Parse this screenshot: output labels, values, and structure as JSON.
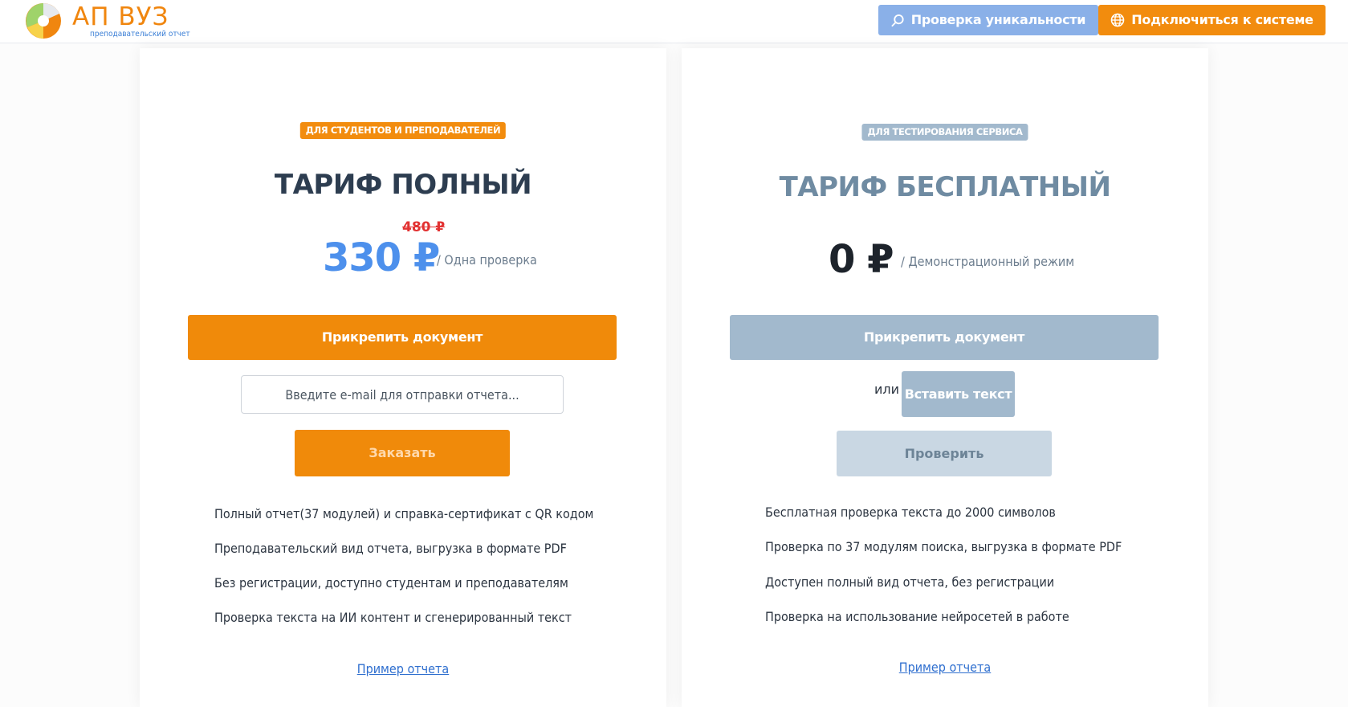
{
  "header": {
    "logo_title": "АП ВУЗ",
    "logo_subtitle": "преподавательский отчет",
    "check_button": "Проверка уникальности",
    "connect_button": "Подключиться к системе",
    "brand_orange": "#f28c0e",
    "brand_blue": "#8ab0e8"
  },
  "plans": {
    "full": {
      "badge": "ДЛЯ СТУДЕНТОВ И ПРЕПОДАВАТЕЛЕЙ",
      "title": "ТАРИФ ПОЛНЫЙ",
      "old_price": "480 ₽",
      "price": "330 ₽",
      "price_note": "/ Одна проверка",
      "attach_button": "Прикрепить документ",
      "email_placeholder": "Введите e-mail для отправки отчета...",
      "order_button": "Заказать",
      "features": [
        "Полный отчет(37 модулей) и справка-сертификат с QR кодом",
        "Преподавательский вид отчета, выгрузка в формате PDF",
        "Без регистрации, доступно студентам и преподавателям",
        "Проверка текста на ИИ контент и сгенерированный текст"
      ],
      "sample_link": "Пример отчета"
    },
    "free": {
      "badge": "ДЛЯ ТЕСТИРОВАНИЯ СЕРВИСА",
      "title": "ТАРИФ БЕСПЛАТНЫЙ",
      "price": "0 ₽",
      "price_note": "/ Демонстрационный режим",
      "attach_button": "Прикрепить документ",
      "or_label": "или",
      "insert_text_button": "Вставить текст",
      "verify_button": "Проверить",
      "features": [
        "Бесплатная проверка текста до 2000 символов",
        "Проверка по 37 модулям поиска, выгрузка в формате PDF",
        "Доступен полный вид отчета, без регистрации",
        "Проверка на использование нейросетей в работе"
      ],
      "sample_link": "Пример отчета"
    }
  }
}
